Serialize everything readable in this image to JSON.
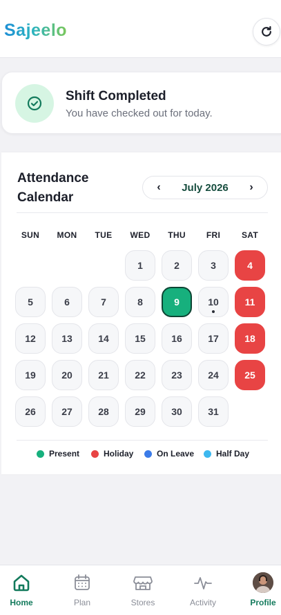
{
  "header": {
    "logo_text": "Sajeelo",
    "refresh_icon": "refresh-icon"
  },
  "shift_card": {
    "title": "Shift Completed",
    "subtitle": "You have checked out for today.",
    "icon": "check-circle-icon",
    "icon_bg": "#d6f5e3",
    "icon_color": "#137a5c"
  },
  "calendar": {
    "title": "Attendance Calendar",
    "month_label": "July 2026",
    "prev_label": "‹",
    "next_label": "›",
    "weekdays": [
      "SUN",
      "MON",
      "TUE",
      "WED",
      "THU",
      "FRI",
      "SAT"
    ],
    "days": [
      {
        "d": "1",
        "status": ""
      },
      {
        "d": "2",
        "status": ""
      },
      {
        "d": "3",
        "status": ""
      },
      {
        "d": "4",
        "status": "holiday"
      },
      {
        "d": "5",
        "status": ""
      },
      {
        "d": "6",
        "status": ""
      },
      {
        "d": "7",
        "status": ""
      },
      {
        "d": "8",
        "status": ""
      },
      {
        "d": "9",
        "status": "present"
      },
      {
        "d": "10",
        "status": "today"
      },
      {
        "d": "11",
        "status": "holiday"
      },
      {
        "d": "12",
        "status": ""
      },
      {
        "d": "13",
        "status": ""
      },
      {
        "d": "14",
        "status": ""
      },
      {
        "d": "15",
        "status": ""
      },
      {
        "d": "16",
        "status": ""
      },
      {
        "d": "17",
        "status": ""
      },
      {
        "d": "18",
        "status": "holiday"
      },
      {
        "d": "19",
        "status": ""
      },
      {
        "d": "20",
        "status": ""
      },
      {
        "d": "21",
        "status": ""
      },
      {
        "d": "22",
        "status": ""
      },
      {
        "d": "23",
        "status": ""
      },
      {
        "d": "24",
        "status": ""
      },
      {
        "d": "25",
        "status": "holiday"
      },
      {
        "d": "26",
        "status": ""
      },
      {
        "d": "27",
        "status": ""
      },
      {
        "d": "28",
        "status": ""
      },
      {
        "d": "29",
        "status": ""
      },
      {
        "d": "30",
        "status": ""
      },
      {
        "d": "31",
        "status": ""
      }
    ],
    "legend": [
      {
        "label": "Present",
        "color": "#17b07d"
      },
      {
        "label": "Holiday",
        "color": "#e84444"
      },
      {
        "label": "On Leave",
        "color": "#3b7be8"
      },
      {
        "label": "Half Day",
        "color": "#3db8ef"
      }
    ]
  },
  "bottom_nav": [
    {
      "label": "Home",
      "icon": "home-icon",
      "active": true
    },
    {
      "label": "Plan",
      "icon": "calendar-icon",
      "active": false
    },
    {
      "label": "Stores",
      "icon": "store-icon",
      "active": false
    },
    {
      "label": "Activity",
      "icon": "activity-icon",
      "active": false
    },
    {
      "label": "Profile",
      "icon": "avatar",
      "active": true
    }
  ],
  "colors": {
    "accent": "#137a5c",
    "holiday": "#e84444",
    "present": "#17b07d"
  }
}
